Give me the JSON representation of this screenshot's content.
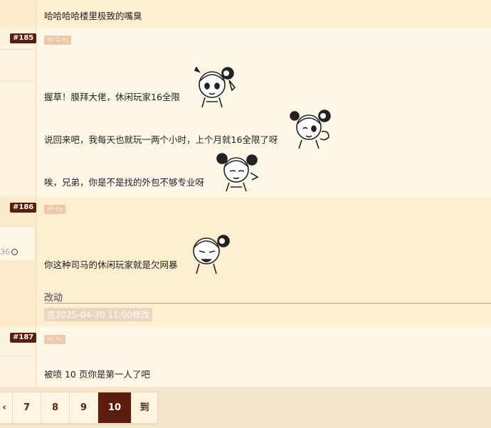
{
  "posts": {
    "top": {
      "text": "哈哈哈哈楼里极致的嘴臭"
    },
    "p185": {
      "floor": "#185",
      "votes": "1",
      "lines": [
        "握草！膜拜大佬，休闲玩家16全限",
        "说回来吧，我每天也就玩一两个小时，上个月就16全限了呀",
        "唉，兄弟，你是不是找的外包不够专业呀"
      ]
    },
    "p186": {
      "floor": "#186",
      "side_text": "36",
      "text": "你这种司马的休闲玩家就是欠网暴",
      "section": "改动",
      "edited": "在2025-04-30 11:00修改"
    },
    "p187": {
      "floor": "#187",
      "text": "被喷 10 页你是第一人了吧"
    }
  },
  "pager": {
    "items": [
      "7",
      "8",
      "9",
      "10",
      "到"
    ],
    "current": "10",
    "left_arrow": "‹"
  },
  "colors": {
    "accent": "#5c1d0e",
    "bg_light": "#fff8e8",
    "bg_dark": "#fdefd0"
  },
  "icons": [
    "thumb-up-icon",
    "thumb-down-icon",
    "sticker-image"
  ]
}
